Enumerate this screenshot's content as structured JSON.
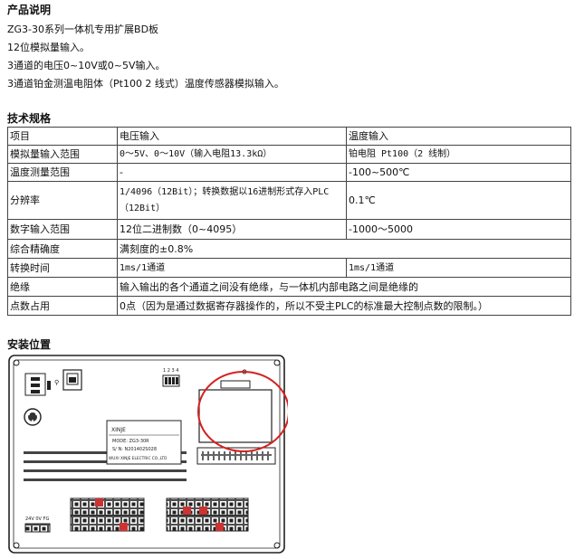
{
  "product": {
    "heading": "产品说明",
    "lines": [
      "ZG3-30系列一体机专用扩展BD板",
      "12位模拟量输入。",
      "3通道的电压0~10V或0~5V输入。",
      "3通道铂金测温电阻体（Pt100 2 线式）温度传感器模拟输入。"
    ]
  },
  "spec": {
    "heading": "技术规格",
    "rows": [
      [
        "项目",
        "电压输入",
        "温度输入"
      ],
      [
        "模拟量输入范围",
        "0～5V、0～10V（输入电阻13.3kΩ）",
        "铂电阻 Pt100（2 线制）"
      ],
      [
        "温度测量范围",
        "-",
        "-100~500℃"
      ],
      [
        "分辨率",
        "1/4096（12Bit）；转换数据以16进制形式存入PLC（12Bit）",
        "0.1℃"
      ],
      [
        "数字输入范围",
        "12位二进制数（0~4095）",
        "-1000～5000"
      ],
      [
        "综合精确度",
        "满刻度的±0.8%"
      ],
      [
        "转换时间",
        "1ms/1通道",
        "1ms/1通道"
      ],
      [
        "绝缘",
        "输入输出的各个通道之间没有绝缘，与一体机内部电路之间是绝缘的"
      ],
      [
        "点数占用",
        "0点（因为是通过数据寄存器操作的，所以不受主PLC的标准最大控制点数的限制。）"
      ]
    ]
  },
  "install": {
    "heading": "安装位置",
    "label_brand": "XINJE",
    "label_model": "MODE: ZG3-30R",
    "label_serial": "S/ N: N201402S028",
    "label_company": "WUXI XINJE ELECTRIC CO.,LTD",
    "switch_numbers": "1 2 3 4",
    "power_label": "24V 0V FG",
    "highlight_color": "#d42020"
  }
}
